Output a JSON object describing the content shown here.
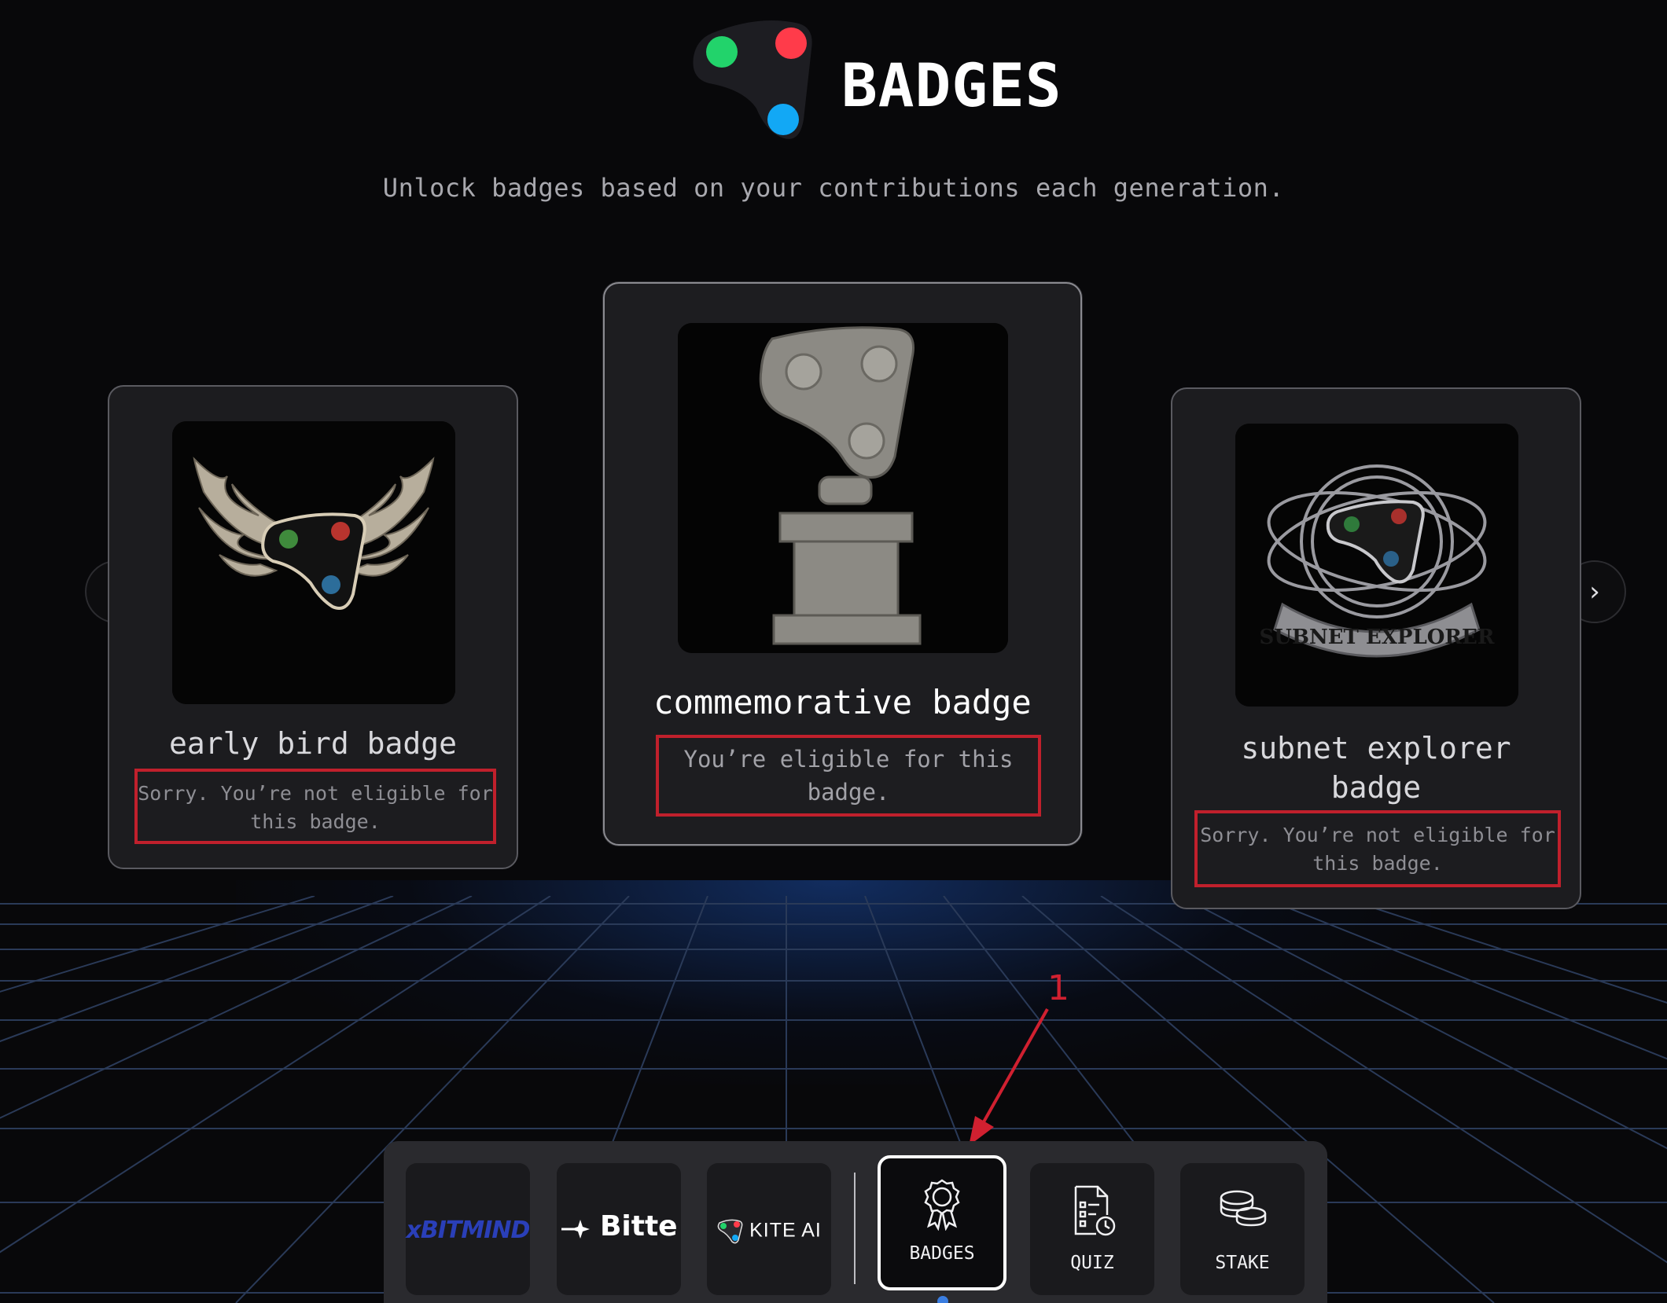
{
  "header": {
    "title": "BADGES",
    "subtitle": "Unlock badges based on your contributions each generation."
  },
  "carousel": {
    "prev_label": "‹",
    "next_label": "›",
    "cards": [
      {
        "name": "early bird badge",
        "message": "Sorry. You’re not eligible for this badge.",
        "eligible": false,
        "image": "winged-logo-badge"
      },
      {
        "name": "commemorative badge",
        "message": "You’re eligible for this badge.",
        "eligible": true,
        "image": "stone-statue-logo-badge"
      },
      {
        "name": "subnet explorer badge",
        "message": "Sorry. You’re not eligible for this badge.",
        "eligible": false,
        "image": "orbit-emblem-badge",
        "banner_text": "SUBNET EXPLORER"
      }
    ]
  },
  "annotation": {
    "label": "1",
    "color": "#d02030"
  },
  "dock": {
    "partners": [
      {
        "brand": "BITMIND",
        "prefix": "x"
      },
      {
        "brand": "Bitte",
        "icon": "sparkle-arrow-icon"
      },
      {
        "brand": "KITE AI",
        "icon": "kite-logo-icon"
      }
    ],
    "nav": [
      {
        "label": "BADGES",
        "icon": "award-ribbon-icon",
        "active": true
      },
      {
        "label": "QUIZ",
        "icon": "quiz-checklist-icon",
        "active": false
      },
      {
        "label": "STAKE",
        "icon": "coins-stack-icon",
        "active": false
      }
    ]
  },
  "colors": {
    "background": "#08080a",
    "card": "#1c1c1f",
    "highlight_box": "#c0202c",
    "logo_green": "#22d36b",
    "logo_red": "#ff3b4a",
    "logo_blue": "#12a8f5",
    "active_indicator": "#3a7de0"
  }
}
